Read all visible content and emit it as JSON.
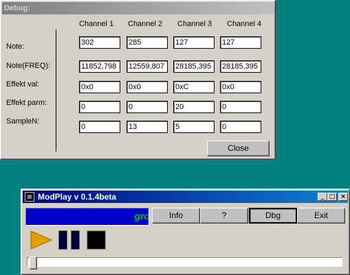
{
  "debug": {
    "title": "Debug:",
    "channels": [
      "Channel 1",
      "Channel 2",
      "Channel 3",
      "Channel 4"
    ],
    "rows": [
      {
        "label": "Note:",
        "values": [
          "302",
          "285",
          "127",
          "127"
        ]
      },
      {
        "label": "Note(FREQ):",
        "values": [
          "11852,798",
          "12559,807",
          "28185,395",
          "28185,395"
        ]
      },
      {
        "label": "Effekt val:",
        "values": [
          "0x0",
          "0x0",
          "0xC",
          "0x0"
        ]
      },
      {
        "label": "Effekt parm:",
        "values": [
          "0",
          "0",
          "20",
          "0"
        ]
      },
      {
        "label": "SampleN:",
        "values": [
          "0",
          "13",
          "5",
          "0"
        ]
      }
    ],
    "close_label": "Close"
  },
  "modplay": {
    "title": "ModPlay v 0.1.4beta",
    "titlebar_buttons": {
      "minimize": "_",
      "maximize": "□",
      "close": "×"
    },
    "scroller_text": "gro",
    "buttons": {
      "info": "Info",
      "help": "?",
      "debug": "Dbg",
      "exit": "Exit"
    },
    "transport_icons": [
      "play-icon",
      "pause-icon",
      "stop-icon"
    ],
    "position_fraction": 0.0
  },
  "colors": {
    "desktop": "#008080",
    "active_title": "#000080",
    "inactive_title": "#808080",
    "scroller_bg": "#0000c8",
    "scroller_text": "#00c000",
    "play": "#e0a000"
  }
}
